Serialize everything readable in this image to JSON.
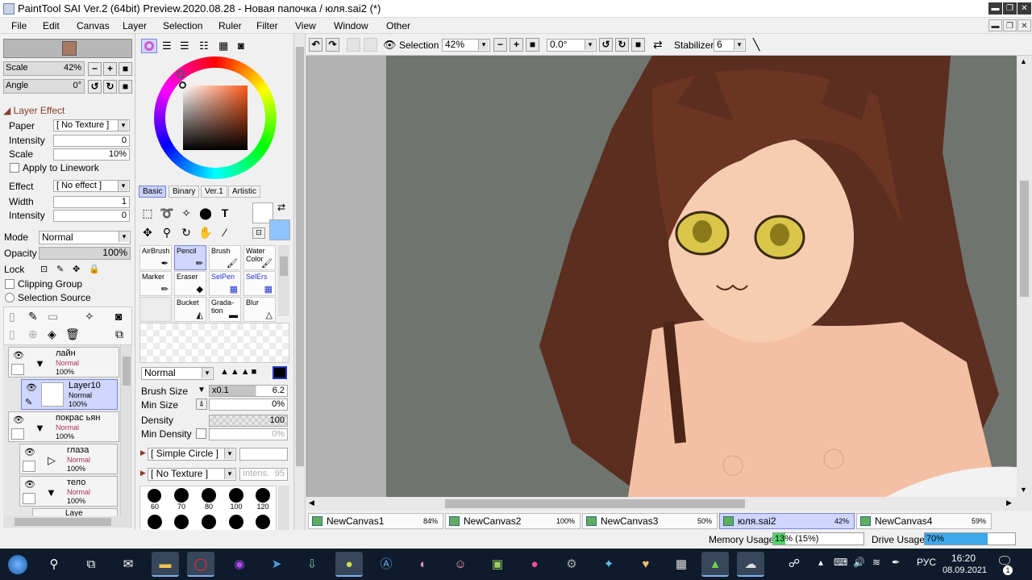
{
  "window": {
    "title": "PaintTool SAI Ver.2 (64bit) Preview.2020.08.28 - Новая папочка / юля.sai2 (*)",
    "minimize": "▬",
    "restore": "❐",
    "close": "✕"
  },
  "menu": [
    "File",
    "Edit",
    "Canvas",
    "Layer",
    "Selection",
    "Ruler",
    "Filter",
    "View",
    "Window",
    "Other"
  ],
  "navigator": {
    "scale_label": "Scale",
    "scale_value": "42%",
    "angle_label": "Angle",
    "angle_value": "0°"
  },
  "layer_effect": {
    "header": "Layer Effect",
    "paper_label": "Paper",
    "paper_value": "[ No Texture ]",
    "intensity_label": "Intensity",
    "intensity_value": "0",
    "scale_label": "Scale",
    "scale_value": "10%",
    "apply_linework": "Apply to Linework",
    "effect_label": "Effect",
    "effect_value": "[ No effect ]",
    "width_label": "Width",
    "width_value": "1",
    "intensity2_label": "Intensity",
    "intensity2_value": "0"
  },
  "layer_props": {
    "mode_label": "Mode",
    "mode_value": "Normal",
    "opacity_label": "Opacity",
    "opacity_value": "100%",
    "lock_label": "Lock",
    "clipping_group": "Clipping Group",
    "selection_source": "Selection Source"
  },
  "layers": [
    {
      "name": "лайн",
      "mode": "Normal",
      "opacity": "100%"
    },
    {
      "name": "Layer10",
      "mode": "Normal",
      "opacity": "100%"
    },
    {
      "name": "покрас ьян",
      "mode": "Normal",
      "opacity": "100%"
    },
    {
      "name": "глаза",
      "mode": "Normal",
      "opacity": "100%"
    },
    {
      "name": "тело",
      "mode": "Normal",
      "opacity": "100%"
    },
    {
      "name": "Laye",
      "mode": "",
      "opacity": ""
    }
  ],
  "color_tabs": [
    "Basic",
    "Binary",
    "Ver.1",
    "Artistic"
  ],
  "tools": [
    {
      "label": "AirBrush",
      "icon": "✒"
    },
    {
      "label": "Pencil",
      "icon": "✏"
    },
    {
      "label": "Brush",
      "icon": "🖌"
    },
    {
      "label": "Water Color",
      "icon": "🖌"
    },
    {
      "label": "Marker",
      "icon": "✏"
    },
    {
      "label": "Eraser",
      "icon": "◆"
    },
    {
      "label": "SelPen",
      "icon": "▦"
    },
    {
      "label": "SelErs",
      "icon": "▦"
    },
    {
      "label": "",
      "icon": ""
    },
    {
      "label": "Bucket",
      "icon": "◭"
    },
    {
      "label": "Grada-tion",
      "icon": "▬"
    },
    {
      "label": "Blur",
      "icon": "△"
    }
  ],
  "brush_settings": {
    "blend_mode": "Normal",
    "size_label": "Brush Size",
    "size_mult": "x0.1",
    "size_value": "6.2",
    "min_size_label": "Min Size",
    "min_size_value": "0%",
    "density_label": "Density",
    "density_value": "100",
    "min_density_label": "Min Density",
    "min_density_value": "0%",
    "shape_value": "[ Simple Circle ]",
    "texture_value": "[ No Texture ]",
    "texture_intensity": "Intens.",
    "texture_intensity_value": "95"
  },
  "brush_dots": [
    "60",
    "70",
    "80",
    "100",
    "120"
  ],
  "canvas_toolbar": {
    "selection_label": "Selection",
    "zoom_value": "42%",
    "angle_value": "0.0°",
    "stabilizer_label": "Stabilizer",
    "stabilizer_value": "6"
  },
  "canvas_tabs": [
    {
      "name": "NewCanvas1",
      "pct": "84%"
    },
    {
      "name": "NewCanvas2",
      "pct": "100%"
    },
    {
      "name": "NewCanvas3",
      "pct": "50%"
    },
    {
      "name": "юля.sai2",
      "pct": "42%"
    },
    {
      "name": "NewCanvas4",
      "pct": "59%"
    }
  ],
  "status": {
    "memory_label": "Memory Usage",
    "memory_value": "13% (15%)",
    "memory_fraction": 0.13,
    "drive_label": "Drive Usage",
    "drive_value": "70%",
    "drive_fraction": 0.7
  },
  "taskbar": {
    "lang": "РУС",
    "time": "16:20",
    "date": "08.09.2021",
    "notification_count": "1"
  }
}
